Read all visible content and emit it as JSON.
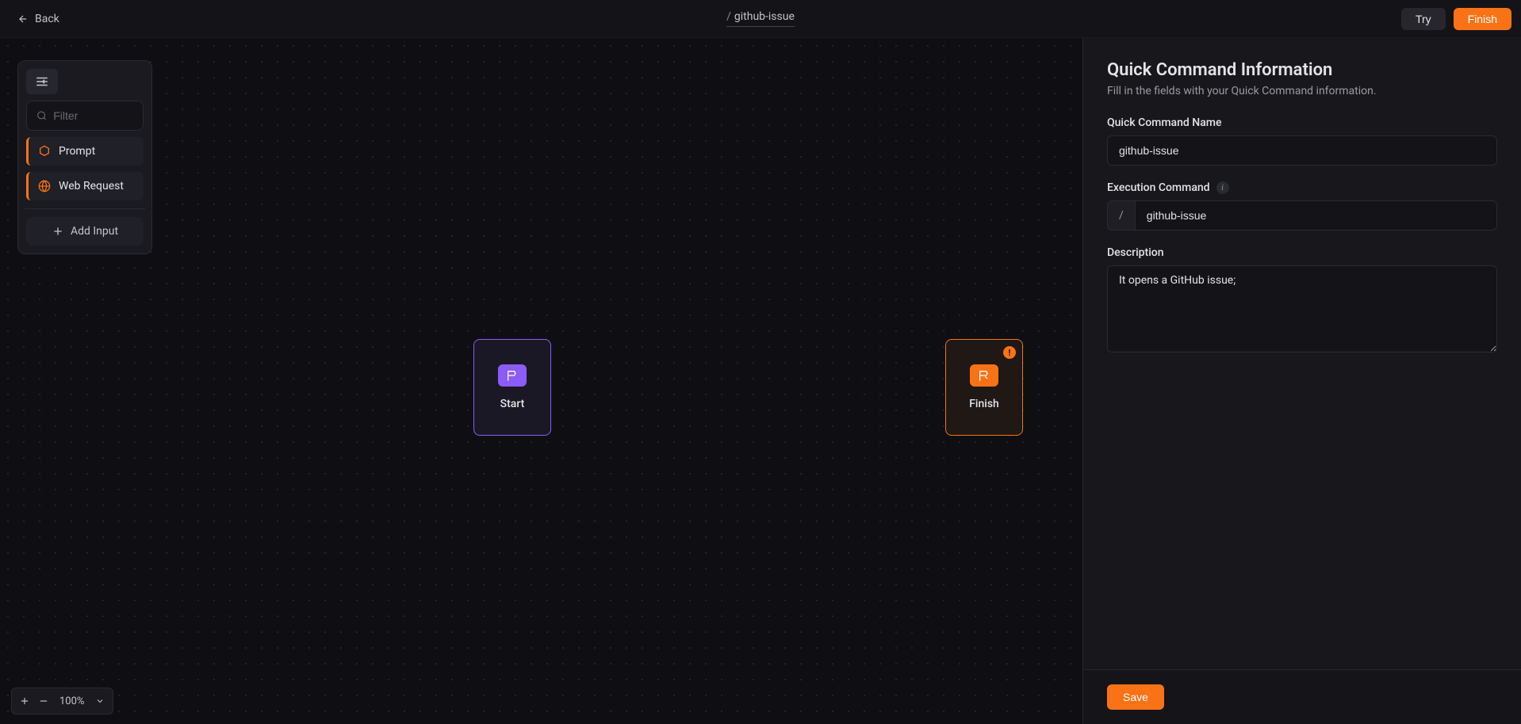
{
  "header": {
    "back_label": "Back",
    "breadcrumb_prefix": "/",
    "breadcrumb_name": "github-issue",
    "try_label": "Try",
    "finish_label": "Finish"
  },
  "side_panel": {
    "filter_placeholder": "Filter",
    "items": [
      {
        "label": "Prompt",
        "icon": "hexagon"
      },
      {
        "label": "Web Request",
        "icon": "globe"
      }
    ],
    "add_input_label": "Add Input"
  },
  "canvas": {
    "nodes": {
      "start": {
        "label": "Start"
      },
      "finish": {
        "label": "Finish",
        "warning_badge": "!"
      }
    },
    "zoom": {
      "level": "100%"
    }
  },
  "right_panel": {
    "title": "Quick Command Information",
    "subtitle": "Fill in the fields with your Quick Command information.",
    "fields": {
      "name": {
        "label": "Quick Command Name",
        "value": "github-issue"
      },
      "execution": {
        "label": "Execution Command",
        "prefix": "/",
        "value": "github-issue"
      },
      "description": {
        "label": "Description",
        "value": "It opens a GitHub issue;"
      }
    },
    "save_label": "Save"
  }
}
